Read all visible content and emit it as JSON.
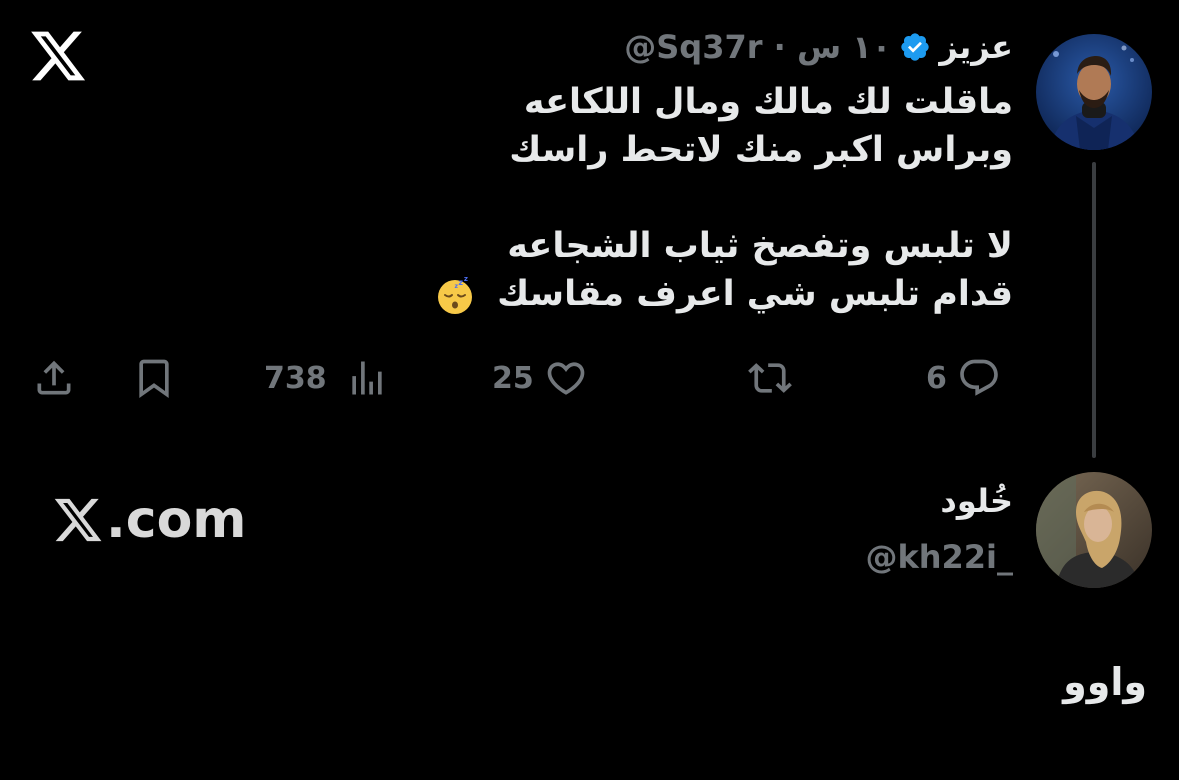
{
  "brand": {
    "logo_icon": "x-logo-icon",
    "watermark": ".com"
  },
  "tweet1": {
    "author_name": "عزيز",
    "verified_icon": "verified-badge-icon",
    "verified_color": "#1d9bf0",
    "meta": "@Sq37r · ١٠ س",
    "lines": [
      "ماقلت لك مالك ومال اللكاعه",
      "وبراس اكبر منك لاتحط راسك",
      "",
      "لا تلبس وتفصخ ثياب الشجاعه",
      "قدام تلبس شي اعرف مقاسك"
    ],
    "emoji_icon": "sleeping-face-emoji",
    "actions": {
      "replies": "6",
      "retweets": "",
      "likes": "25",
      "views": "738"
    }
  },
  "tweet2": {
    "author_name": "خُلود",
    "handle": "@kh22i_",
    "text": "واوو"
  },
  "colors": {
    "background": "#000000",
    "text_primary": "#e7e9ea",
    "text_secondary": "#71767b",
    "accent": "#1d9bf0"
  }
}
